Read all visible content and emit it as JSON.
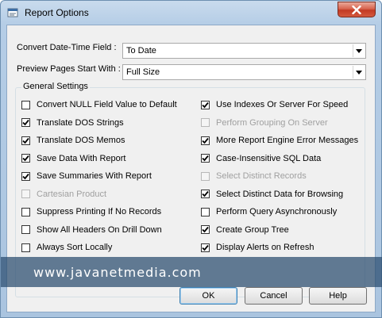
{
  "window": {
    "title": "Report Options",
    "close_icon": "close-icon"
  },
  "fields": {
    "convert_date_label": "Convert Date-Time Field :",
    "convert_date_value": "To Date",
    "preview_start_label": "Preview Pages Start With :",
    "preview_start_value": "Full Size"
  },
  "general_settings": {
    "title": "General Settings",
    "left": [
      {
        "label": "Convert NULL Field Value to Default",
        "checked": false,
        "enabled": true
      },
      {
        "label": "Translate DOS Strings",
        "checked": true,
        "enabled": true
      },
      {
        "label": "Translate DOS Memos",
        "checked": true,
        "enabled": true
      },
      {
        "label": "Save Data With Report",
        "checked": true,
        "enabled": true
      },
      {
        "label": "Save Summaries With Report",
        "checked": true,
        "enabled": true
      },
      {
        "label": "Cartesian Product",
        "checked": false,
        "enabled": false
      },
      {
        "label": "Suppress Printing If No Records",
        "checked": false,
        "enabled": true
      },
      {
        "label": "Show All Headers On Drill Down",
        "checked": false,
        "enabled": true
      },
      {
        "label": "Always Sort Locally",
        "checked": false,
        "enabled": true
      }
    ],
    "right": [
      {
        "label": "Use Indexes Or Server For Speed",
        "checked": true,
        "enabled": true
      },
      {
        "label": "Perform Grouping On Server",
        "checked": false,
        "enabled": false
      },
      {
        "label": "More Report Engine Error Messages",
        "checked": true,
        "enabled": true
      },
      {
        "label": "Case-Insensitive SQL Data",
        "checked": true,
        "enabled": true
      },
      {
        "label": "Select Distinct Records",
        "checked": false,
        "enabled": false
      },
      {
        "label": "Select Distinct Data for Browsing",
        "checked": true,
        "enabled": true
      },
      {
        "label": "Perform Query Asynchronously",
        "checked": false,
        "enabled": true
      },
      {
        "label": "Create Group Tree",
        "checked": true,
        "enabled": true
      },
      {
        "label": "Display Alerts on Refresh",
        "checked": true,
        "enabled": true
      }
    ]
  },
  "buttons": {
    "ok": "OK",
    "cancel": "Cancel",
    "help": "Help"
  },
  "watermark": "www.javanetmedia.com"
}
